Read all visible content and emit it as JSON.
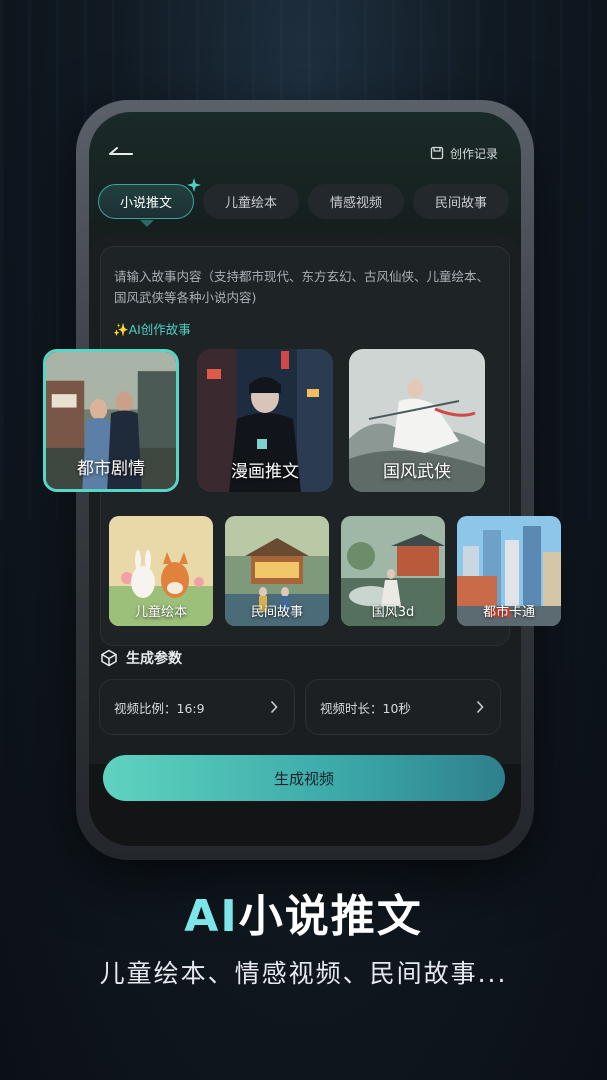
{
  "header": {
    "records_label": "创作记录"
  },
  "tabs": [
    {
      "label": "小说推文",
      "active": true
    },
    {
      "label": "儿童绘本",
      "active": false
    },
    {
      "label": "情感视频",
      "active": false
    },
    {
      "label": "民间故事",
      "active": false
    }
  ],
  "input": {
    "placeholder": "请输入故事内容（支持都市现代、东方玄幻、古风仙侠、儿童绘本、国风武侠等各种小说内容)",
    "ai_create_label": "✨AI创作故事"
  },
  "styles_primary": [
    {
      "label": "都市剧情",
      "selected": true
    },
    {
      "label": "漫画推文",
      "selected": false
    },
    {
      "label": "国风武侠",
      "selected": false
    }
  ],
  "styles_secondary": [
    {
      "label": "儿童绘本"
    },
    {
      "label": "民间故事"
    },
    {
      "label": "国风3d"
    },
    {
      "label": "都市卡通"
    }
  ],
  "params": {
    "title": "生成参数",
    "ratio_label": "视频比例：16:9",
    "duration_label": "视频时长：10秒"
  },
  "generate_button": "生成视频",
  "promo": {
    "headline_ai": "AI",
    "headline_rest": "小说推文",
    "subline": "儿童绘本、情感视频、民间故事..."
  },
  "colors": {
    "accent": "#57d6c6",
    "button_start": "#5fd3c0",
    "button_end": "#2f7f8d"
  }
}
